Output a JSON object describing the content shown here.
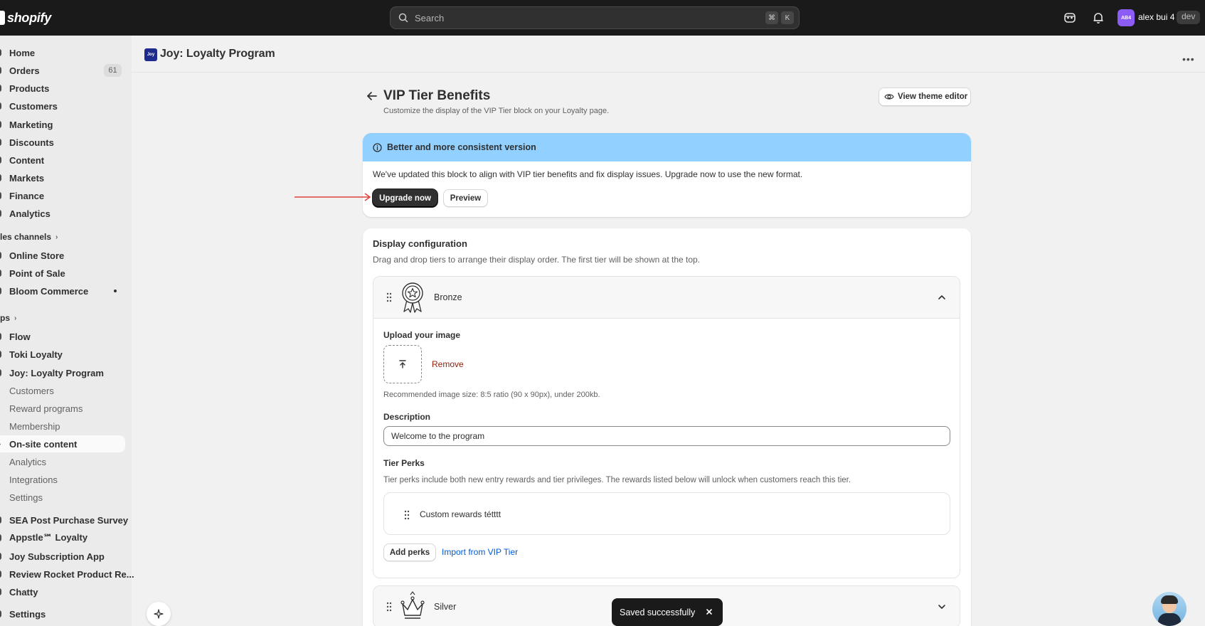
{
  "topbar": {
    "logo_text": "shopify",
    "search_placeholder": "Search",
    "kbd_cmd": "⌘",
    "kbd_k": "K",
    "avatar_initials": "AB4",
    "user_name": "alex bui 4",
    "env_badge": "dev"
  },
  "sidebar": {
    "main_items": [
      {
        "label": "Home"
      },
      {
        "label": "Orders",
        "count": "61"
      },
      {
        "label": "Products"
      },
      {
        "label": "Customers"
      },
      {
        "label": "Marketing"
      },
      {
        "label": "Discounts"
      },
      {
        "label": "Content"
      },
      {
        "label": "Markets"
      },
      {
        "label": "Finance"
      },
      {
        "label": "Analytics"
      }
    ],
    "sales_channels_label": "les channels",
    "sales_channels": [
      {
        "label": "Online Store"
      },
      {
        "label": "Point of Sale"
      },
      {
        "label": "Bloom Commerce"
      }
    ],
    "apps_label": "ps",
    "apps": [
      {
        "label": "Flow"
      },
      {
        "label": "Toki Loyalty"
      },
      {
        "label": "Joy: Loyalty Program"
      }
    ],
    "joy_sub": [
      {
        "label": "Customers"
      },
      {
        "label": "Reward programs"
      },
      {
        "label": "Membership"
      },
      {
        "label": "On-site content"
      },
      {
        "label": "Analytics"
      },
      {
        "label": "Integrations"
      },
      {
        "label": "Settings"
      }
    ],
    "more_apps": [
      {
        "label": "SEA Post Purchase Survey"
      },
      {
        "label": "Appstle℠ Loyalty"
      },
      {
        "label": "Joy Subscription App"
      },
      {
        "label": "Review Rocket Product Re..."
      },
      {
        "label": "Chatty"
      }
    ],
    "settings_label": "Settings"
  },
  "app_header": {
    "logo_text": "Joy",
    "title": "Joy: Loyalty Program"
  },
  "page": {
    "title": "VIP Tier Benefits",
    "subtitle": "Customize the display of the VIP Tier block on your Loyalty page.",
    "theme_button": "View theme editor"
  },
  "banner": {
    "title": "Better and more consistent version",
    "text": "We've updated this block to align with VIP tier benefits and fix display issues. Upgrade now to use the new format.",
    "primary_button": "Upgrade now",
    "secondary_button": "Preview"
  },
  "config": {
    "title": "Display configuration",
    "subtitle": "Drag and drop tiers to arrange their display order. The first tier will be shown at the top.",
    "tiers": [
      {
        "name": "Bronze",
        "upload_label": "Upload your image",
        "remove_label": "Remove",
        "image_help": "Recommended image size: 8:5 ratio (90 x 90px), under 200kb.",
        "description_label": "Description",
        "description_value": "Welcome to the program",
        "perks_label": "Tier Perks",
        "perks_help": "Tier perks include both new entry rewards and tier privileges. The rewards listed below will unlock when customers reach this tier.",
        "perks": [
          "Custom rewards tétttt"
        ],
        "add_perks_button": "Add perks",
        "import_link": "Import from VIP Tier"
      },
      {
        "name": "Silver"
      }
    ]
  },
  "toast": {
    "text": "Saved successfully"
  }
}
